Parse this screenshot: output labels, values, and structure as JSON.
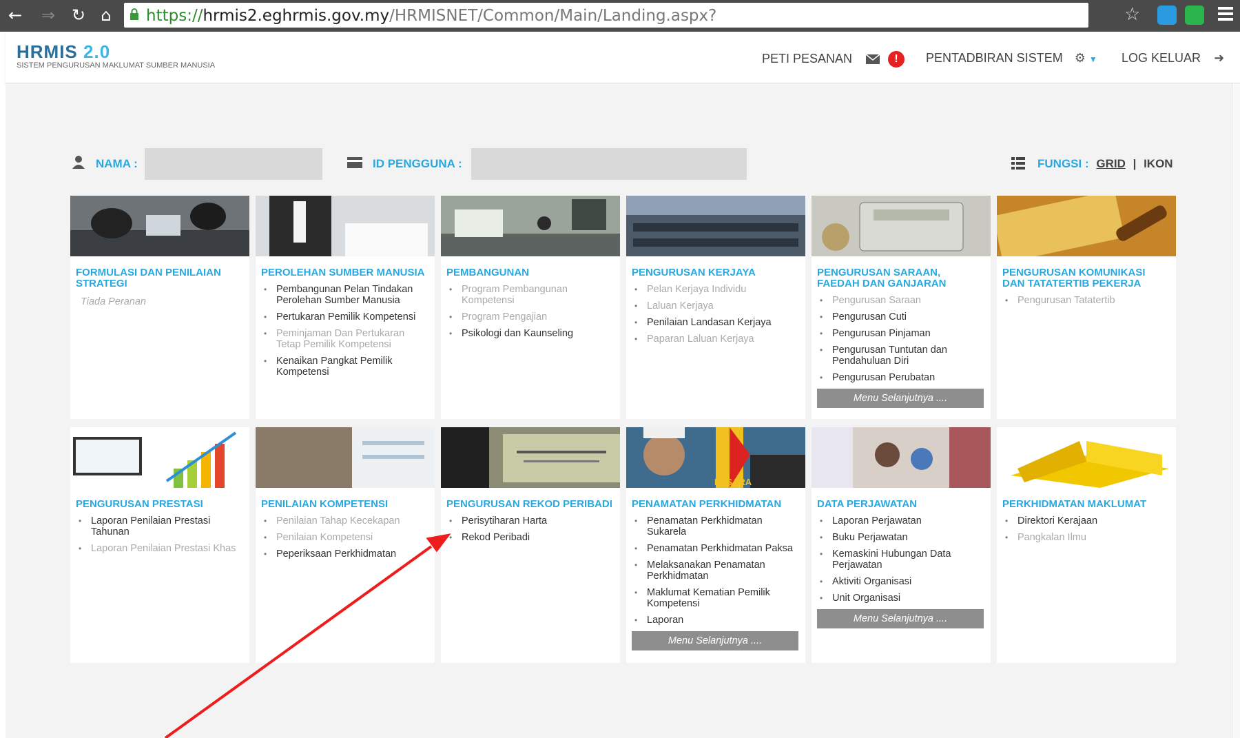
{
  "browser": {
    "url_scheme": "https://",
    "url_host": "hrmis2.eghrmis.gov.my",
    "url_path": "/HRMISNET/Common/Main/Landing.aspx?"
  },
  "header": {
    "logo_main": "HRMIS",
    "logo_version": "2.0",
    "logo_subtitle": "SISTEM PENGURUSAN MAKLUMAT SUMBER MANUSIA",
    "inbox_label": "PETI PESANAN",
    "inbox_badge": "!",
    "admin_label": "PENTADBIRAN SISTEM",
    "logout_label": "LOG KELUAR"
  },
  "userbar": {
    "name_label": "NAMA :",
    "id_label": "ID PENGGUNA :",
    "fungsi_label": "FUNGSI :",
    "grid_label": "GRID",
    "separator": "|",
    "ikon_label": "IKON"
  },
  "tiles": [
    {
      "title": "FORMULASI DAN PENILAIAN STRATEGI",
      "empty_text": "Tiada Peranan"
    },
    {
      "title": "PEROLEHAN SUMBER MANUSIA",
      "items": [
        "Pembangunan Pelan Tindakan Perolehan Sumber Manusia",
        "Pertukaran Pemilik Kompetensi",
        "Peminjaman Dan Pertukaran Tetap Pemilik Kompetensi",
        "Kenaikan Pangkat Pemilik Kompetensi"
      ]
    },
    {
      "title": "PEMBANGUNAN",
      "items": [
        "Program Pembangunan Kompetensi",
        "Program Pengajian",
        "Psikologi dan Kaunseling"
      ]
    },
    {
      "title": "PENGURUSAN KERJAYA",
      "items": [
        "Pelan Kerjaya Individu",
        "Laluan Kerjaya",
        "Penilaian Landasan Kerjaya",
        "Paparan Laluan Kerjaya"
      ]
    },
    {
      "title": "PENGURUSAN SARAAN, FAEDAH DAN GANJARAN",
      "items": [
        "Pengurusan Saraan",
        "Pengurusan Cuti",
        "Pengurusan Pinjaman",
        "Pengurusan Tuntutan dan Pendahuluan Diri",
        "Pengurusan Perubatan"
      ],
      "more": "Menu Selanjutnya ...."
    },
    {
      "title": "PENGURUSAN KOMUNIKASI DAN TATATERTIB PEKERJA",
      "items": [
        "Pengurusan Tatatertib"
      ]
    },
    {
      "title": "PENGURUSAN PRESTASI",
      "items": [
        "Laporan Penilaian Prestasi Tahunan",
        "Laporan Penilaian Prestasi Khas"
      ]
    },
    {
      "title": "PENILAIAN KOMPETENSI",
      "items": [
        "Penilaian Tahap Kecekapan",
        "Penilaian Kompetensi",
        "Peperiksaan Perkhidmatan"
      ]
    },
    {
      "title": "PENGURUSAN REKOD PERIBADI",
      "items": [
        "Perisytiharan Harta",
        "Rekod Peribadi"
      ]
    },
    {
      "title": "PENAMATAN PERKHIDMATAN",
      "items": [
        "Penamatan Perkhidmatan Sukarela",
        "Penamatan Perkhidmatan Paksa",
        "Melaksanakan Penamatan Perkhidmatan",
        "Maklumat Kematian Pemilik Kompetensi",
        "Laporan"
      ],
      "more": "Menu Selanjutnya ...."
    },
    {
      "title": "DATA PERJAWATAN",
      "items": [
        "Laporan Perjawatan",
        "Buku Perjawatan",
        "Kemaskini Hubungan Data Perjawatan",
        "Aktiviti Organisasi",
        "Unit Organisasi"
      ],
      "more": "Menu Selanjutnya ...."
    },
    {
      "title": "PERKHIDMATAN MAKLUMAT",
      "items": [
        "Direktori Kerajaan",
        "Pangkalan Ilmu"
      ]
    }
  ],
  "image_labels": {
    "pesara": "PESARA"
  },
  "colors": {
    "accent": "#29a8e0",
    "badge": "#e52222",
    "arrow": "#ee1c1c",
    "disabled": "#aaaaaa"
  }
}
